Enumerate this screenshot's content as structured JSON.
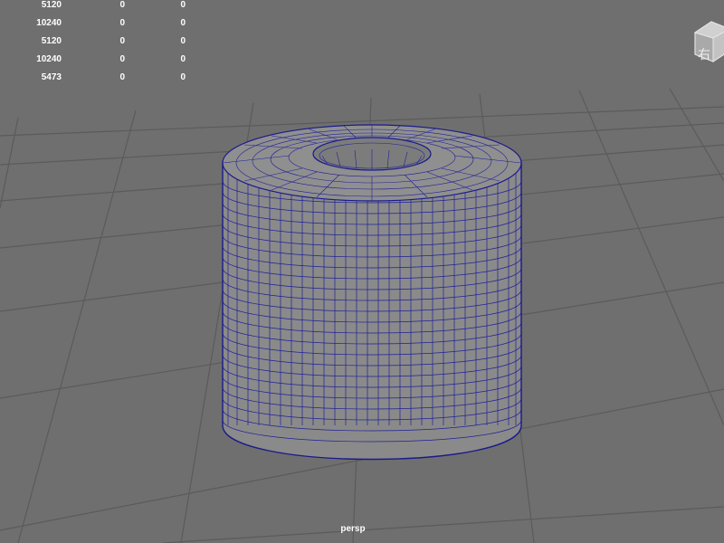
{
  "viewport": {
    "camera_label": "persp",
    "view_cube_face": "右"
  },
  "heads_up_display": {
    "rows": [
      [
        "5120",
        "0",
        "0"
      ],
      [
        "10240",
        "0",
        "0"
      ],
      [
        "5120",
        "0",
        "0"
      ],
      [
        "10240",
        "0",
        "0"
      ],
      [
        "5473",
        "0",
        "0"
      ]
    ]
  },
  "colors": {
    "background": "#6f6f6f",
    "grid": "#5a5a5a",
    "mesh_surface": "#8a8a8a",
    "wireframe": "#1a1a8c",
    "hud_text": "#ffffff"
  }
}
